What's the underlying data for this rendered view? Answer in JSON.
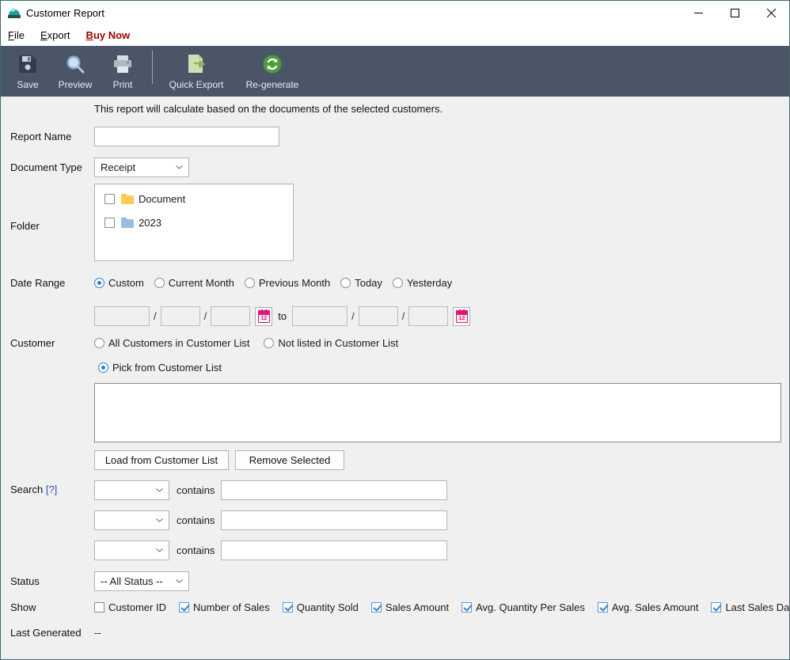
{
  "window": {
    "title": "Customer Report",
    "icon": "app-icon",
    "controls": {
      "minimize": "minimize",
      "maximize": "maximize",
      "close": "close"
    }
  },
  "menu": {
    "items": [
      {
        "label": "File",
        "accel": "F",
        "style": "normal"
      },
      {
        "label": "Export",
        "accel": "E",
        "style": "normal"
      },
      {
        "label": "Buy Now",
        "accel": "B",
        "style": "promo"
      }
    ]
  },
  "toolbar": {
    "items": [
      {
        "label": "Save",
        "icon": "floppy-disk-icon"
      },
      {
        "label": "Preview",
        "icon": "magnifier-icon"
      },
      {
        "label": "Print",
        "icon": "printer-icon"
      },
      {
        "label": "Quick Export",
        "icon": "document-export-icon"
      },
      {
        "label": "Re-generate",
        "icon": "refresh-icon"
      }
    ]
  },
  "form": {
    "note": "This report will calculate based on the documents of the selected customers.",
    "report_name": {
      "label": "Report Name",
      "value": "",
      "placeholder": ""
    },
    "document_type": {
      "label": "Document Type",
      "value": "Receipt"
    },
    "folder": {
      "label": "Folder",
      "items": [
        {
          "label": "Document",
          "checked": false,
          "icon": "folder-icon",
          "color": "#f7cd55"
        },
        {
          "label": "2023",
          "checked": false,
          "icon": "folder-icon",
          "color": "#9cbde3"
        }
      ]
    },
    "date_range": {
      "label": "Date Range",
      "options": [
        {
          "label": "Custom",
          "selected": true
        },
        {
          "label": "Current Month",
          "selected": false
        },
        {
          "label": "Previous Month",
          "selected": false
        },
        {
          "label": "Today",
          "selected": false
        },
        {
          "label": "Yesterday",
          "selected": false
        }
      ],
      "from": {
        "d1": "",
        "d2": "",
        "d3": ""
      },
      "to_label": "to",
      "to": {
        "d1": "",
        "d2": "",
        "d3": ""
      },
      "separator": "/",
      "calendar_icon": "calendar-icon",
      "calendar_day": "12"
    },
    "customer": {
      "label": "Customer",
      "options": [
        {
          "label": "All Customers in Customer List",
          "selected": false
        },
        {
          "label": "Not listed in Customer List",
          "selected": false
        },
        {
          "label": "Pick from Customer List",
          "selected": true
        }
      ],
      "list_value": "",
      "buttons": [
        {
          "label": "Load from Customer List"
        },
        {
          "label": "Remove Selected"
        }
      ]
    },
    "search": {
      "label": "Search",
      "help_link": "[?]",
      "operator": "contains",
      "rows": [
        {
          "field": "",
          "value": ""
        },
        {
          "field": "",
          "value": ""
        },
        {
          "field": "",
          "value": ""
        }
      ]
    },
    "status": {
      "label": "Status",
      "value": "-- All Status --"
    },
    "show": {
      "label": "Show",
      "items": [
        {
          "label": "Customer ID",
          "checked": false
        },
        {
          "label": "Number of Sales",
          "checked": true
        },
        {
          "label": "Quantity Sold",
          "checked": true
        },
        {
          "label": "Sales Amount",
          "checked": true
        },
        {
          "label": "Avg. Quantity Per Sales",
          "checked": true
        },
        {
          "label": "Avg. Sales Amount",
          "checked": true
        },
        {
          "label": "Last Sales Date",
          "checked": true
        }
      ]
    },
    "last_generated": {
      "label": "Last Generated",
      "value": "--"
    }
  }
}
